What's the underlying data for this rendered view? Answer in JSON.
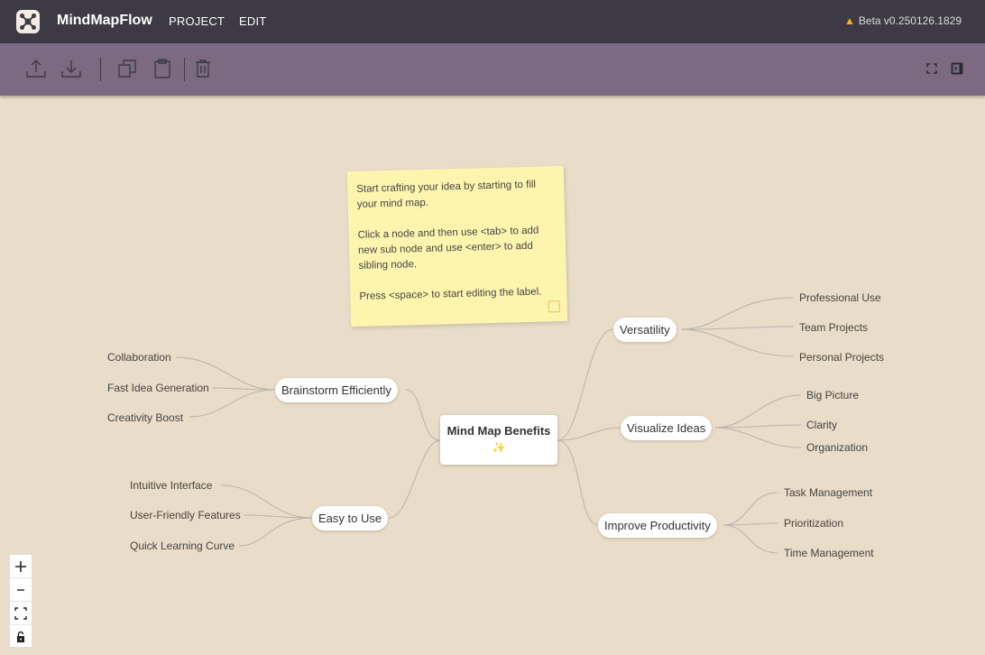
{
  "header": {
    "brand": "MindMapFlow",
    "menu": [
      "PROJECT",
      "EDIT"
    ],
    "version": "Beta v0.250126.1829"
  },
  "toolbar": {
    "buttons": [
      "upload-icon",
      "download-icon",
      "copy-icon",
      "paste-icon",
      "delete-icon"
    ],
    "right_buttons": [
      "fullscreen-icon",
      "panel-toggle-icon"
    ]
  },
  "sticky_note": {
    "line1": "Start crafting your idea by starting to fill your mind map.",
    "line2": "Click a node and then use <tab> to add new sub node and use <enter> to add sibling node.",
    "line3": "Press <space>  to start editing the label."
  },
  "mindmap": {
    "root": {
      "label": "Mind Map Benefits",
      "emoji": "✨"
    },
    "branches": {
      "brainstorm": {
        "label": "Brainstorm Efficiently",
        "children": [
          "Collaboration",
          "Fast Idea Generation",
          "Creativity Boost"
        ]
      },
      "easy": {
        "label": "Easy to Use",
        "children": [
          "Intuitive Interface",
          "User-Friendly Features",
          "Quick Learning Curve"
        ]
      },
      "versatility": {
        "label": "Versatility",
        "children": [
          "Professional Use",
          "Team Projects",
          "Personal Projects"
        ]
      },
      "visualize": {
        "label": "Visualize Ideas",
        "children": [
          "Big Picture",
          "Clarity",
          "Organization"
        ]
      },
      "productivity": {
        "label": "Improve Productivity",
        "children": [
          "Task Management",
          "Prioritization",
          "Time Management"
        ]
      }
    }
  },
  "zoom_controls": [
    "zoom-in-icon",
    "zoom-out-icon",
    "fit-view-icon",
    "lock-icon"
  ],
  "colors": {
    "header": "#3d3a45",
    "toolbar": "#7b6a82",
    "canvas": "#e9dcc8",
    "sticky": "#fdf5ae",
    "edge": "#b9b3ac"
  }
}
